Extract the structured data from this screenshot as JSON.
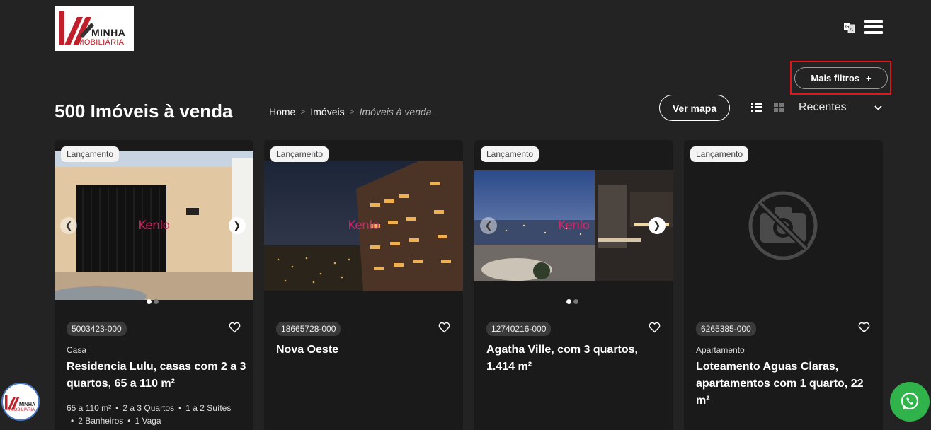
{
  "brand": {
    "line1": "MINHA",
    "line2": "IMOBILIÁRIA",
    "colors": {
      "red": "#c0202b",
      "dark": "#222222"
    }
  },
  "header": {
    "translate_icon": "translate-icon",
    "menu_icon": "hamburger-menu-icon"
  },
  "filters": {
    "more_label": "Mais filtros",
    "plus": "+"
  },
  "listing": {
    "title": "500 Imóveis à venda",
    "breadcrumb": [
      "Home",
      "Imóveis",
      "Imóveis à venda"
    ],
    "breadcrumb_sep": ">",
    "map_button": "Ver mapa",
    "sort": {
      "selected": "Recentes"
    }
  },
  "watermark": "Kenlo",
  "cards": [
    {
      "badge": "Lançamento",
      "code": "5003423-000",
      "type": "Casa",
      "title": "Residencia Lulu, casas com 2 a 3 quartos, 65 a 110 m²",
      "features": [
        "65 a 110 m²",
        "2 a 3 Quartos",
        "1 a 2 Suítes",
        "2 Banheiros",
        "1 Vaga"
      ]
    },
    {
      "badge": "Lançamento",
      "code": "18665728-000",
      "type": "",
      "title": "Nova Oeste",
      "features": []
    },
    {
      "badge": "Lançamento",
      "code": "12740216-000",
      "type": "",
      "title": "Agatha Ville, com 3 quartos, 1.414 m²",
      "features": []
    },
    {
      "badge": "Lançamento",
      "code": "6265385-000",
      "type": "Apartamento",
      "title": "Loteamento Aguas Claras, apartamentos com 1 quarto, 22 m²",
      "features": []
    }
  ],
  "colors": {
    "background": "#232323",
    "card": "#1a1a1a",
    "highlight": "#e3141b",
    "whatsapp": "#2fb34a",
    "watermark": "#e0256b"
  }
}
